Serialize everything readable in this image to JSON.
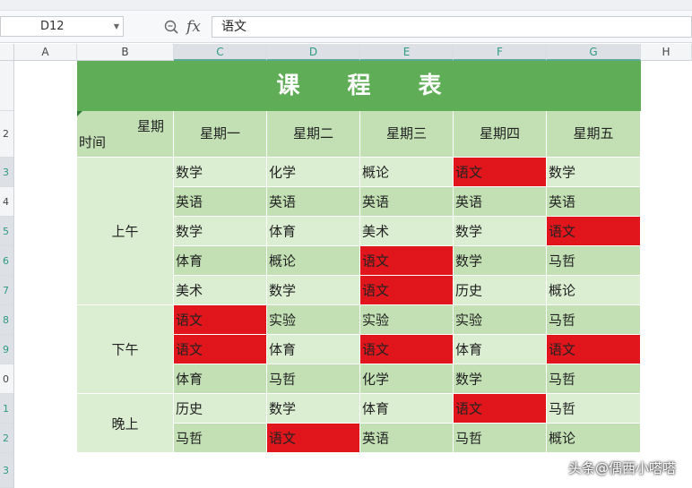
{
  "formula_bar": {
    "cell_ref": "D12",
    "zoom_icon": "magnifier-icon",
    "fx_label": "fx",
    "value": "语文"
  },
  "columns": [
    "A",
    "B",
    "C",
    "D",
    "E",
    "F",
    "G",
    "H"
  ],
  "selected_columns": [
    "C",
    "D",
    "E",
    "F",
    "G"
  ],
  "rows": [
    "",
    "2",
    "3",
    "4",
    "5",
    "6",
    "7",
    "8",
    "9",
    "0",
    "1",
    "2",
    "3"
  ],
  "selected_rows": [
    "3",
    "5",
    "6",
    "7",
    "8",
    "9",
    "1",
    "2"
  ],
  "colors": {
    "title_bg": "#5fad56",
    "header_bg": "#c3e0b4",
    "light_row": "#dbeed2",
    "highlight": "#e0161c"
  },
  "table": {
    "title": "课 程 表",
    "corner_top": "星期",
    "corner_bottom": "时间",
    "days": [
      "星期一",
      "星期二",
      "星期三",
      "星期四",
      "星期五"
    ],
    "periods": [
      {
        "name": "上午",
        "rows": [
          [
            "数学",
            "化学",
            "概论",
            "语文",
            "数学"
          ],
          [
            "英语",
            "英语",
            "英语",
            "英语",
            "英语"
          ],
          [
            "数学",
            "体育",
            "美术",
            "数学",
            "语文"
          ],
          [
            "体育",
            "概论",
            "语文",
            "数学",
            "马哲"
          ],
          [
            "美术",
            "数学",
            "语文",
            "历史",
            "概论"
          ]
        ]
      },
      {
        "name": "下午",
        "rows": [
          [
            "语文",
            "实验",
            "实验",
            "实验",
            "马哲"
          ],
          [
            "语文",
            "体育",
            "语文",
            "体育",
            "语文"
          ],
          [
            "体育",
            "马哲",
            "化学",
            "数学",
            "马哲"
          ]
        ]
      },
      {
        "name": "晚上",
        "rows": [
          [
            "历史",
            "数学",
            "体育",
            "语文",
            "马哲"
          ],
          [
            "马哲",
            "语文",
            "英语",
            "马哲",
            "概论"
          ]
        ]
      }
    ],
    "highlight_subject": "语文"
  },
  "watermark": "头条@偶西小嗒嗒"
}
